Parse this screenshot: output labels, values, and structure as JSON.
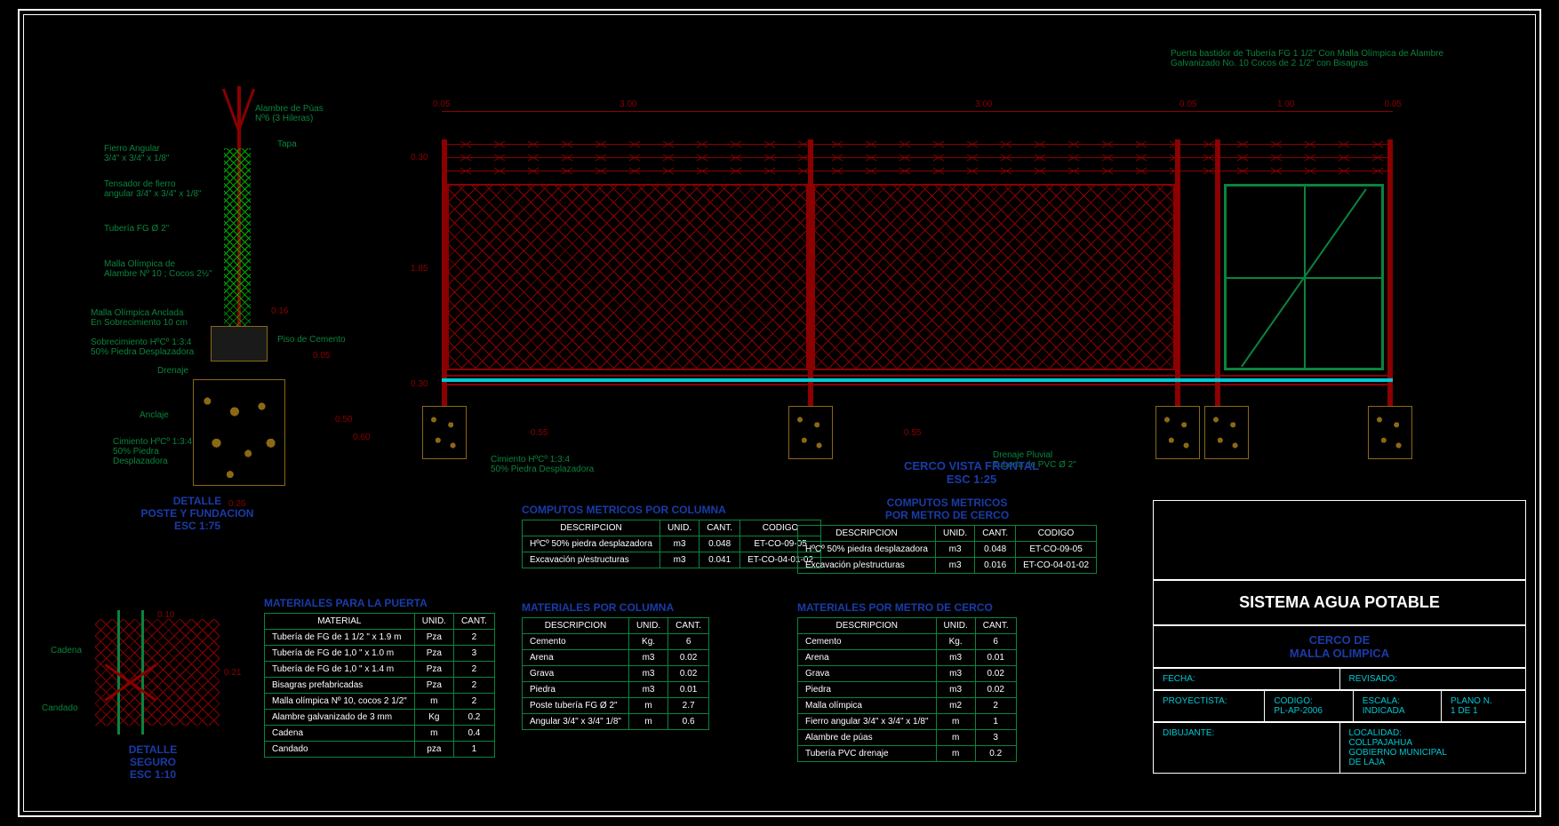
{
  "detail_post": {
    "title": "DETALLE",
    "subtitle": "POSTE Y FUNDACION",
    "scale": "ESC 1:75",
    "annotations": {
      "alambre": "Alambre de Púas\nNº6 (3 Hileras)",
      "tapa": "Tapa",
      "fierro_angular": "Fierro Angular\n3/4\" x 3/4\" x 1/8\"",
      "tensador": "Tensador de fierro\nangular 3/4\" x 3/4\" x 1/8\"",
      "tuberia": "Tubería FG Ø 2\"",
      "malla": "Malla Olímpica de\nAlambre Nº 10 ; Cocos 2½\"",
      "malla_anclada": "Malla Olímpica Anclada\nEn Sobrecimiento 10 cm",
      "sobrecimiento": "Sobrecimiento HºCº 1:3:4\n50% Piedra Desplazadora",
      "piso": "Piso de Cemento",
      "drenaje": "Drenaje",
      "anclaje": "Anclaje",
      "cimiento": "Cimiento HºCº 1:3:4\n50% Piedra\nDesplazadora"
    },
    "dims": {
      "d016": "0.16",
      "d005": "0.05",
      "d050": "0.50",
      "d060": "0.60",
      "d026": "0.26"
    }
  },
  "elevation": {
    "title": "CERCO VISTA FRONTAL",
    "scale": "ESC 1:25",
    "gate_note": "Puerta bastidor de Tubería FG 1 1/2\" Con Malla Olímpica de Alambre\nGalvanizado No. 10 Cocos de 2 1/2\" con Bisagras",
    "cimiento_note": "Cimiento HºCº 1:3:4\n50% Piedra Desplazadora",
    "drenaje_note": "Drenaje Pluvial\nTubería de PVC Ø 2\"",
    "dims": {
      "span1": "3.00",
      "span2": "3.00",
      "gate": "1.00",
      "h_barbed": "0.30",
      "h_mesh": "1.85",
      "h_base": "0.30",
      "h_foot": "0.55",
      "edge": "0.05"
    }
  },
  "lock_detail": {
    "title": "DETALLE",
    "subtitle": "SEGURO",
    "scale": "ESC 1:10",
    "cadena": "Cadena",
    "candado": "Candado",
    "dims": {
      "w": "0.10",
      "h": "0.21"
    }
  },
  "tables": {
    "mat_puerta": {
      "title": "MATERIALES PARA LA PUERTA",
      "headers": [
        "MATERIAL",
        "UNID.",
        "CANT."
      ],
      "rows": [
        [
          "Tubería de FG de 1 1/2 \" x 1.9 m",
          "Pza",
          "2"
        ],
        [
          "Tubería de FG de 1,0 \" x 1.0 m",
          "Pza",
          "3"
        ],
        [
          "Tubería de FG de 1,0 \" x 1.4 m",
          "Pza",
          "2"
        ],
        [
          "Bisagras prefabricadas",
          "Pza",
          "2"
        ],
        [
          "Malla olímpica Nº 10, cocos 2 1/2\"",
          "m",
          "2"
        ],
        [
          "Alambre galvanizado de 3 mm",
          "Kg",
          "0.2"
        ],
        [
          "Cadena",
          "m",
          "0.4"
        ],
        [
          "Candado",
          "pza",
          "1"
        ]
      ]
    },
    "comp_col": {
      "title": "COMPUTOS METRICOS POR COLUMNA",
      "headers": [
        "DESCRIPCION",
        "UNID.",
        "CANT.",
        "CODIGO"
      ],
      "rows": [
        [
          "HºCº 50% piedra desplazadora",
          "m3",
          "0.048",
          "ET-CO-09-05"
        ],
        [
          "Excavación p/estructuras",
          "m3",
          "0.041",
          "ET-CO-04-01-02"
        ]
      ]
    },
    "comp_cerco": {
      "title1": "COMPUTOS METRICOS",
      "title2": "POR METRO DE CERCO",
      "headers": [
        "DESCRIPCION",
        "UNID.",
        "CANT.",
        "CODIGO"
      ],
      "rows": [
        [
          "HºCº 50% piedra desplazadora",
          "m3",
          "0.048",
          "ET-CO-09-05"
        ],
        [
          "Excavación p/estructuras",
          "m3",
          "0.016",
          "ET-CO-04-01-02"
        ]
      ]
    },
    "mat_col": {
      "title": "MATERIALES POR COLUMNA",
      "headers": [
        "DESCRIPCION",
        "UNID.",
        "CANT."
      ],
      "rows": [
        [
          "Cemento",
          "Kg.",
          "6"
        ],
        [
          "Arena",
          "m3",
          "0.02"
        ],
        [
          "Grava",
          "m3",
          "0.02"
        ],
        [
          "Piedra",
          "m3",
          "0.01"
        ],
        [
          "Poste tubería FG Ø 2\"",
          "m",
          "2.7"
        ],
        [
          "Angular 3/4\" x 3/4\" 1/8\"",
          "m",
          "0.6"
        ]
      ]
    },
    "mat_cerco": {
      "title": "MATERIALES POR METRO DE CERCO",
      "headers": [
        "DESCRIPCION",
        "UNID.",
        "CANT."
      ],
      "rows": [
        [
          "Cemento",
          "Kg.",
          "6"
        ],
        [
          "Arena",
          "m3",
          "0.01"
        ],
        [
          "Grava",
          "m3",
          "0.02"
        ],
        [
          "Piedra",
          "m3",
          "0.02"
        ],
        [
          "Malla olímpica",
          "m2",
          "2"
        ],
        [
          "Fierro angular 3/4\" x 3/4\" x 1/8\"",
          "m",
          "1"
        ],
        [
          "Alambre de púas",
          "m",
          "3"
        ],
        [
          "Tubería PVC drenaje",
          "m",
          "0.2"
        ]
      ]
    }
  },
  "title_block": {
    "proyecto": "SISTEMA AGUA POTABLE",
    "plano_de1": "CERCO DE",
    "plano_de2": "MALLA OLIMPICA",
    "fecha_lbl": "FECHA:",
    "revisado_lbl": "REVISADO:",
    "proyectista_lbl": "PROYECTISTA:",
    "codigo_lbl": "CODIGO:",
    "codigo_val": "PL-AP-2006",
    "escala_lbl": "ESCALA:",
    "escala_val": "INDICADA",
    "plano_n_lbl": "PLANO N.",
    "plano_n_val": "1 DE 1",
    "dibujante_lbl": "DIBUJANTE:",
    "localidad_lbl": "LOCALIDAD:",
    "localidad_val1": "COLLPAJAHUA",
    "localidad_val2": "GOBIERNO MUNICIPAL",
    "localidad_val3": "DE LAJA"
  }
}
